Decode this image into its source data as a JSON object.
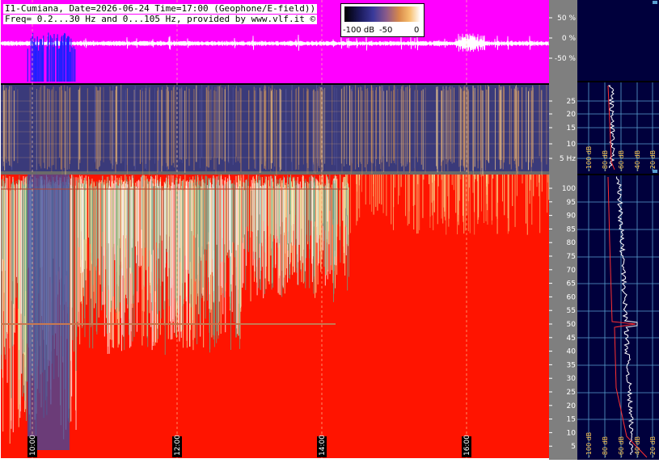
{
  "header": {
    "line1": "I1-Cumiana, Date=2026-06-24 Time=17:00 (Geophone/E-field))",
    "line2": "Freq= 0.2...30 Hz and 0...105 Hz, provided by www.vlf.it ©"
  },
  "colorbar": {
    "ticks": [
      "-100 dB",
      "-50",
      "0"
    ]
  },
  "colors": {
    "waveform_bg": "#ff00ff",
    "high_band_bg": "#ff1400",
    "axis_panel_bg": "#7f7f7f",
    "side_panel_bg": "#00003c",
    "grid_line": "#5aa0d0"
  },
  "chart_data": [
    {
      "type": "line",
      "panel": "waveform",
      "ylabel": "",
      "y_ticks": [
        "50 %",
        "0 %",
        "-50 %"
      ],
      "ylim": [
        -100,
        100
      ]
    },
    {
      "type": "heatmap",
      "panel": "low_band_spectrogram",
      "y_ticks": [
        "25",
        "20",
        "15",
        "10",
        "5 Hz"
      ],
      "ylim": [
        0.2,
        30
      ],
      "x_ticks": [
        "10:00",
        "12:00",
        "14:00",
        "16:00"
      ]
    },
    {
      "type": "heatmap",
      "panel": "high_band_spectrogram",
      "y_ticks": [
        "100",
        "95",
        "90",
        "85",
        "80",
        "75",
        "70",
        "65",
        "60",
        "55",
        "50",
        "45",
        "40",
        "35",
        "30",
        "25",
        "20",
        "15",
        "10",
        "5"
      ],
      "ylim": [
        0,
        105
      ],
      "x_ticks": [
        "10:00",
        "12:00",
        "14:00",
        "16:00"
      ]
    },
    {
      "type": "line",
      "panel": "low_band_spectrum",
      "x_ticks": [
        "-100 dB",
        "-80 dB",
        "-60 dB",
        "-40 dB",
        "-20 dB"
      ]
    },
    {
      "type": "line",
      "panel": "high_band_spectrum",
      "x_ticks": [
        "-100 dB",
        "-80 dB",
        "-60 dB",
        "-40 dB",
        "-20 dB"
      ]
    }
  ]
}
